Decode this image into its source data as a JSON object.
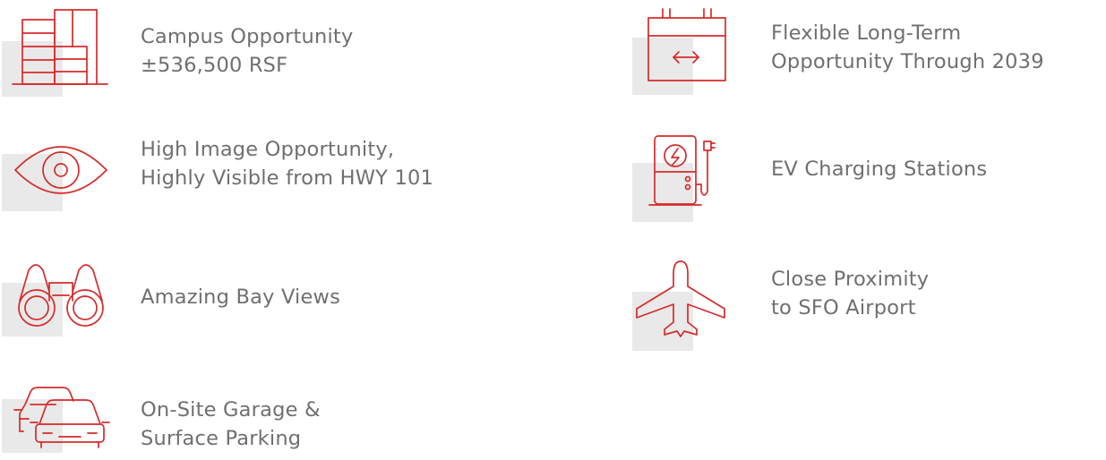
{
  "colors": {
    "accent": "#d52b2b",
    "text": "#6f6f6f",
    "icon_bg": "#e9e9e9"
  },
  "features": [
    {
      "icon": "buildings-icon",
      "lines": [
        "Campus Opportunity",
        "±536,500 RSF"
      ]
    },
    {
      "icon": "eye-icon",
      "lines": [
        "High Image Opportunity,",
        "Highly Visible from HWY 101"
      ]
    },
    {
      "icon": "binoculars-icon",
      "lines": [
        "Amazing Bay Views"
      ]
    },
    {
      "icon": "cars-icon",
      "lines": [
        "On-Site Garage &",
        "Surface Parking"
      ]
    },
    {
      "icon": "calendar-arrows-icon",
      "lines": [
        "Flexible Long-Term",
        "Opportunity Through 2039"
      ]
    },
    {
      "icon": "ev-charger-icon",
      "lines": [
        "EV Charging Stations"
      ]
    },
    {
      "icon": "airplane-icon",
      "lines": [
        "Close Proximity",
        "to SFO Airport"
      ]
    }
  ]
}
